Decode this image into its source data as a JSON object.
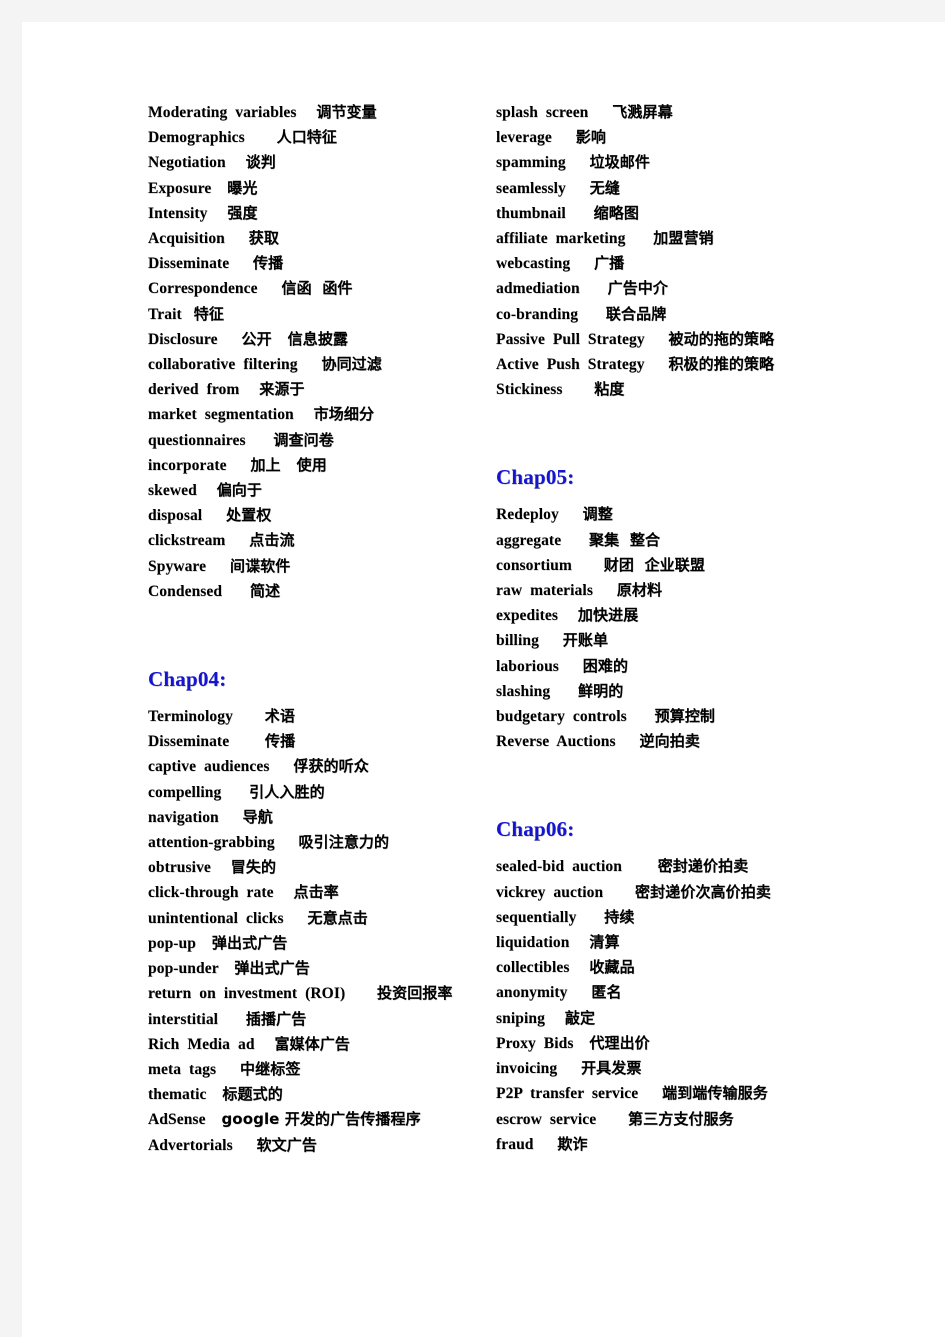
{
  "document": {
    "title": "E-commerce Vocabulary Glossary",
    "page_background": "#ffffff",
    "margin_background": "#f4f4f4",
    "heading_color": "#1414d2",
    "body_color": "#000000"
  },
  "left_column": {
    "blocks": [
      {
        "type": "list",
        "entries": [
          {
            "en": "Moderating  variables",
            "gap": "     ",
            "zh": "调节变量"
          },
          {
            "en": "Demographics",
            "gap": "        ",
            "zh": "人口特征"
          },
          {
            "en": "Negotiation",
            "gap": "     ",
            "zh": "谈判"
          },
          {
            "en": "Exposure",
            "gap": "    ",
            "zh": "曝光"
          },
          {
            "en": "Intensity",
            "gap": "     ",
            "zh": "强度"
          },
          {
            "en": "Acquisition",
            "gap": "      ",
            "zh": "获取"
          },
          {
            "en": "Disseminate",
            "gap": "      ",
            "zh": "传播"
          },
          {
            "en": "Correspondence",
            "gap": "      ",
            "zh": "信函  函件"
          },
          {
            "en": "Trait",
            "gap": "   ",
            "zh": "特征"
          },
          {
            "en": "Disclosure",
            "gap": "      ",
            "zh": "公开   信息披露"
          },
          {
            "en": "collaborative  filtering",
            "gap": "      ",
            "zh": "协同过滤"
          },
          {
            "en": "derived  from",
            "gap": "     ",
            "zh": "来源于"
          },
          {
            "en": "market  segmentation",
            "gap": "     ",
            "zh": "市场细分"
          },
          {
            "en": "questionnaires",
            "gap": "       ",
            "zh": "调查问卷"
          },
          {
            "en": "incorporate",
            "gap": "      ",
            "zh": "加上   使用"
          },
          {
            "en": "skewed",
            "gap": "     ",
            "zh": "偏向于"
          },
          {
            "en": "disposal",
            "gap": "      ",
            "zh": "处置权"
          },
          {
            "en": "clickstream",
            "gap": "      ",
            "zh": "点击流"
          },
          {
            "en": "Spyware",
            "gap": "      ",
            "zh": "间谍软件"
          },
          {
            "en": "Condensed",
            "gap": "       ",
            "zh": "简述"
          }
        ]
      },
      {
        "type": "heading",
        "label": "Chap04:"
      },
      {
        "type": "list",
        "entries": [
          {
            "en": "Terminology",
            "gap": "        ",
            "zh": "术语"
          },
          {
            "en": "Disseminate",
            "gap": "         ",
            "zh": "传播"
          },
          {
            "en": "captive  audiences",
            "gap": "      ",
            "zh": "俘获的听众"
          },
          {
            "en": "compelling",
            "gap": "       ",
            "zh": "引人入胜的"
          },
          {
            "en": "navigation",
            "gap": "      ",
            "zh": "导航"
          },
          {
            "en": "attention-grabbing",
            "gap": "      ",
            "zh": "吸引注意力的"
          },
          {
            "en": "obtrusive",
            "gap": "     ",
            "zh": "冒失的"
          },
          {
            "en": "click-through  rate",
            "gap": "     ",
            "zh": "点击率"
          },
          {
            "en": "unintentional  clicks",
            "gap": "      ",
            "zh": "无意点击"
          },
          {
            "en": "pop-up",
            "gap": "    ",
            "zh": "弹出式广告"
          },
          {
            "en": "pop-under",
            "gap": "    ",
            "zh": "弹出式广告"
          },
          {
            "en": "return  on  investment  (ROI)",
            "gap": "        ",
            "zh": "投资回报率"
          },
          {
            "en": "interstitial",
            "gap": "       ",
            "zh": "插播广告"
          },
          {
            "en": "Rich  Media  ad",
            "gap": "     ",
            "zh": "富媒体广告"
          },
          {
            "en": "meta  tags",
            "gap": "      ",
            "zh": "中继标签"
          },
          {
            "en": "thematic",
            "gap": "    ",
            "zh": "标题式的"
          },
          {
            "en": "AdSense",
            "gap": "    ",
            "zh": "google 开发的广告传播程序"
          },
          {
            "en": "Advertorials",
            "gap": "      ",
            "zh": "软文广告"
          }
        ]
      }
    ]
  },
  "right_column": {
    "blocks": [
      {
        "type": "list",
        "entries": [
          {
            "en": "splash  screen",
            "gap": "      ",
            "zh": "飞溅屏幕"
          },
          {
            "en": "leverage",
            "gap": "      ",
            "zh": "影响"
          },
          {
            "en": "spamming",
            "gap": "      ",
            "zh": "垃圾邮件"
          },
          {
            "en": "seamlessly",
            "gap": "      ",
            "zh": "无缝"
          },
          {
            "en": "thumbnail",
            "gap": "       ",
            "zh": "缩略图"
          },
          {
            "en": "affiliate  marketing",
            "gap": "       ",
            "zh": "加盟营销"
          },
          {
            "en": "webcasting",
            "gap": "      ",
            "zh": "广播"
          },
          {
            "en": "admediation",
            "gap": "       ",
            "zh": "广告中介"
          },
          {
            "en": "co-branding",
            "gap": "       ",
            "zh": "联合品牌"
          },
          {
            "en": "Passive  Pull  Strategy",
            "gap": "      ",
            "zh": "被动的拖的策略"
          },
          {
            "en": "Active  Push  Strategy",
            "gap": "      ",
            "zh": "积极的推的策略"
          },
          {
            "en": "Stickiness",
            "gap": "        ",
            "zh": "粘度"
          }
        ]
      },
      {
        "type": "heading",
        "label": "Chap05:"
      },
      {
        "type": "list",
        "entries": [
          {
            "en": "Redeploy",
            "gap": "      ",
            "zh": "调整"
          },
          {
            "en": "aggregate",
            "gap": "       ",
            "zh": "聚集  整合"
          },
          {
            "en": "consortium",
            "gap": "        ",
            "zh": "财团  企业联盟"
          },
          {
            "en": "raw  materials",
            "gap": "      ",
            "zh": "原材料"
          },
          {
            "en": "expedites",
            "gap": "     ",
            "zh": "加快进展"
          },
          {
            "en": "billing",
            "gap": "      ",
            "zh": "开账单"
          },
          {
            "en": "laborious",
            "gap": "      ",
            "zh": "困难的"
          },
          {
            "en": "slashing",
            "gap": "       ",
            "zh": "鲜明的"
          },
          {
            "en": "budgetary  controls",
            "gap": "       ",
            "zh": "预算控制"
          },
          {
            "en": "Reverse  Auctions",
            "gap": "      ",
            "zh": "逆向拍卖"
          }
        ]
      },
      {
        "type": "heading",
        "label": "Chap06:"
      },
      {
        "type": "list",
        "entries": [
          {
            "en": "sealed-bid  auction",
            "gap": "         ",
            "zh": "密封递价拍卖"
          },
          {
            "en": "vickrey  auction",
            "gap": "        ",
            "zh": "密封递价次高价拍卖"
          },
          {
            "en": "sequentially",
            "gap": "       ",
            "zh": "持续"
          },
          {
            "en": "liquidation",
            "gap": "     ",
            "zh": "清算"
          },
          {
            "en": "collectibles",
            "gap": "     ",
            "zh": "收藏品"
          },
          {
            "en": "anonymity",
            "gap": "      ",
            "zh": "匿名"
          },
          {
            "en": "sniping",
            "gap": "     ",
            "zh": "敲定"
          },
          {
            "en": "Proxy  Bids",
            "gap": "    ",
            "zh": "代理出价"
          },
          {
            "en": "invoicing",
            "gap": "      ",
            "zh": "开具发票"
          },
          {
            "en": "P2P  transfer  service",
            "gap": "      ",
            "zh": "端到端传输服务"
          },
          {
            "en": "escrow  service",
            "gap": "        ",
            "zh": "第三方支付服务"
          },
          {
            "en": "fraud",
            "gap": "      ",
            "zh": "欺诈"
          }
        ]
      }
    ]
  }
}
